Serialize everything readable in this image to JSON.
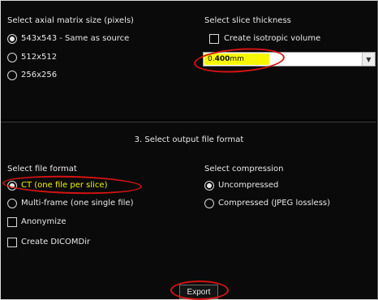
{
  "matrix": {
    "heading": "Select axial matrix size (pixels)",
    "options": [
      "543x543 - Same as source",
      "512x512",
      "256x256"
    ],
    "selected_index": 0
  },
  "thickness": {
    "heading": "Select slice thickness",
    "isotropic_label": "Create isotropic volume",
    "isotropic_checked": false,
    "value_prefix": "0.",
    "value_bold": "400",
    "value_unit": "mm",
    "dropdown_icon": "chevron-down-icon"
  },
  "output": {
    "section_title": "3. Select output file format",
    "format_heading": "Select file format",
    "format_options": [
      "CT (one file per slice)",
      "Multi-frame (one single file)"
    ],
    "format_selected_index": 0,
    "anonymize_label": "Anonymize",
    "anonymize_checked": false,
    "dicomdir_label": "Create DICOMDir",
    "dicomdir_checked": false,
    "compression_heading": "Select compression",
    "compression_options": [
      "Uncompressed",
      "Compressed (JPEG lossless)"
    ],
    "compression_selected_index": 0
  },
  "export_label": "Export",
  "colors": {
    "background": "#050505",
    "text": "#e8e8e8",
    "highlight_yellow": "#f7f700",
    "annotation_red": "#d51313"
  }
}
